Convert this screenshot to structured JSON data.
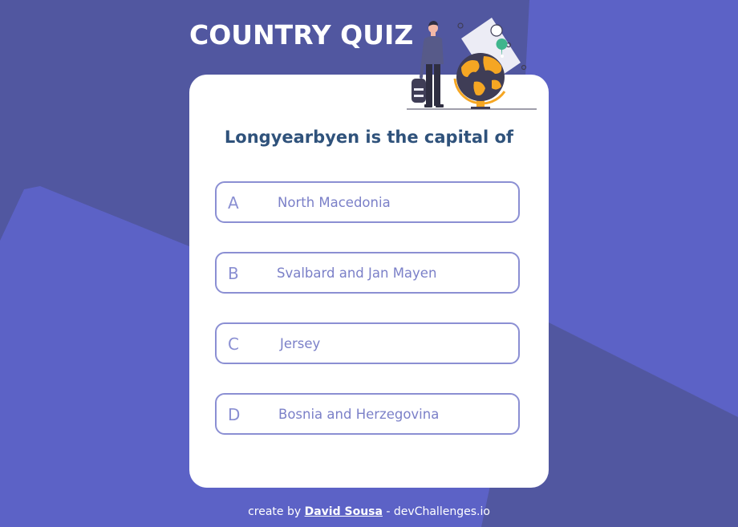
{
  "header": {
    "title": "COUNTRY QUIZ",
    "illustration_icon": "person-with-globe-illustration"
  },
  "quiz": {
    "question": "Longyearbyen is the capital of",
    "options": [
      {
        "letter": "A",
        "text": "North Macedonia"
      },
      {
        "letter": "B",
        "text": "Svalbard and Jan Mayen"
      },
      {
        "letter": "C",
        "text": "Jersey"
      },
      {
        "letter": "D",
        "text": "Bosnia and Herzegovina"
      }
    ]
  },
  "footer": {
    "prefix": "create by",
    "author": "David Sousa",
    "separator": "-",
    "site": "devChallenges.io"
  },
  "colors": {
    "background": "#5157a0",
    "background_shape": "#5e63c5",
    "title": "#ffffff",
    "question": "#2f527b",
    "option_border": "#8b8fd3",
    "option_text": "#7b80c8"
  }
}
